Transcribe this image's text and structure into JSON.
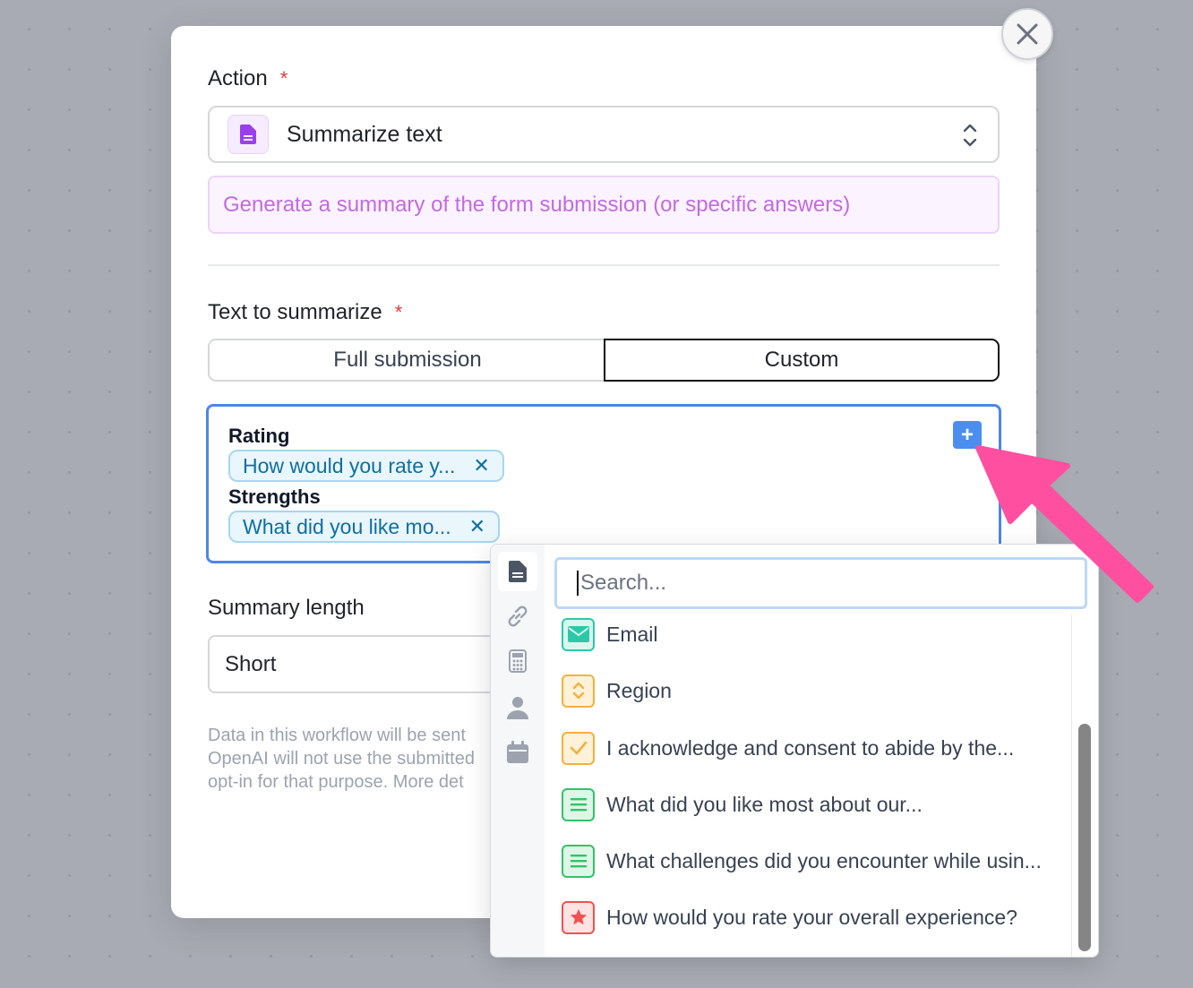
{
  "action": {
    "label": "Action",
    "required_mark": "*",
    "selected": "Summarize text",
    "description": "Generate a summary of the form submission (or specific answers)"
  },
  "text_to_summarize": {
    "label": "Text to summarize",
    "required_mark": "*",
    "segments": [
      "Full submission",
      "Custom"
    ],
    "selected_segment": "Custom",
    "fields": [
      {
        "label": "Rating",
        "chip": "How would you rate y..."
      },
      {
        "label": "Strengths",
        "chip": "What did you like mo..."
      }
    ]
  },
  "summary_length": {
    "label": "Summary length",
    "value": "Short"
  },
  "note_lines": [
    "Data in this workflow will be sent",
    "OpenAI will not use the submitted",
    "opt-in for that purpose. More det"
  ],
  "dropdown": {
    "search_placeholder": "Search...",
    "tabs": [
      "document-icon",
      "link-icon",
      "calculator-icon",
      "person-icon",
      "calendar-icon"
    ],
    "items": [
      {
        "label": "Email",
        "icon": "envelope-icon",
        "color": "#2cc9a9"
      },
      {
        "label": "Region",
        "icon": "select-chevrons-icon",
        "color": "#f4b13e"
      },
      {
        "label": "I acknowledge and consent to abide by the...",
        "icon": "checkbox-icon",
        "color": "#f4b13e"
      },
      {
        "label": "What did you like most about our...",
        "icon": "text-lines-icon",
        "color": "#34c26a"
      },
      {
        "label": "What challenges did you encounter while usin...",
        "icon": "text-lines-icon",
        "color": "#34c26a"
      },
      {
        "label": "How would you rate your overall experience?",
        "icon": "star-icon",
        "color": "#ef5350"
      }
    ]
  },
  "colors": {
    "accent_blue": "#4f86e6",
    "pointer_pink": "#ff4fa0",
    "chip_text": "#0e6fa3",
    "description_purple": "#c26be0"
  }
}
